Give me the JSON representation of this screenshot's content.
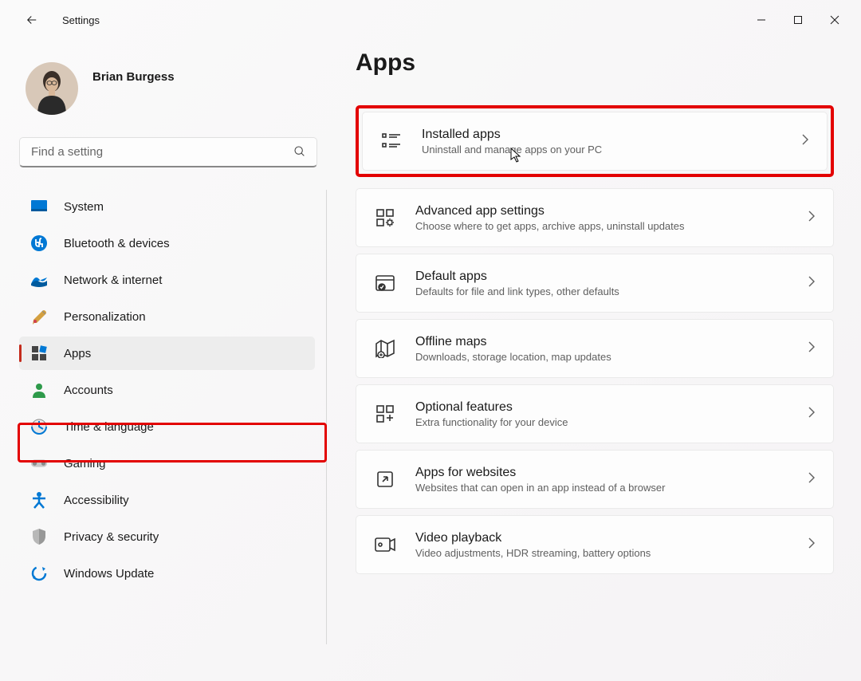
{
  "window": {
    "title": "Settings"
  },
  "profile": {
    "name": "Brian Burgess"
  },
  "search": {
    "placeholder": "Find a setting"
  },
  "nav": {
    "items": [
      {
        "label": "System"
      },
      {
        "label": "Bluetooth & devices"
      },
      {
        "label": "Network & internet"
      },
      {
        "label": "Personalization"
      },
      {
        "label": "Apps"
      },
      {
        "label": "Accounts"
      },
      {
        "label": "Time & language"
      },
      {
        "label": "Gaming"
      },
      {
        "label": "Accessibility"
      },
      {
        "label": "Privacy & security"
      },
      {
        "label": "Windows Update"
      }
    ],
    "active_index": 4,
    "highlighted_index": 4
  },
  "page": {
    "title": "Apps"
  },
  "settings": [
    {
      "title": "Installed apps",
      "sub": "Uninstall and manage apps on your PC",
      "highlighted": true
    },
    {
      "title": "Advanced app settings",
      "sub": "Choose where to get apps, archive apps, uninstall updates"
    },
    {
      "title": "Default apps",
      "sub": "Defaults for file and link types, other defaults"
    },
    {
      "title": "Offline maps",
      "sub": "Downloads, storage location, map updates"
    },
    {
      "title": "Optional features",
      "sub": "Extra functionality for your device"
    },
    {
      "title": "Apps for websites",
      "sub": "Websites that can open in an app instead of a browser"
    },
    {
      "title": "Video playback",
      "sub": "Video adjustments, HDR streaming, battery options"
    }
  ]
}
